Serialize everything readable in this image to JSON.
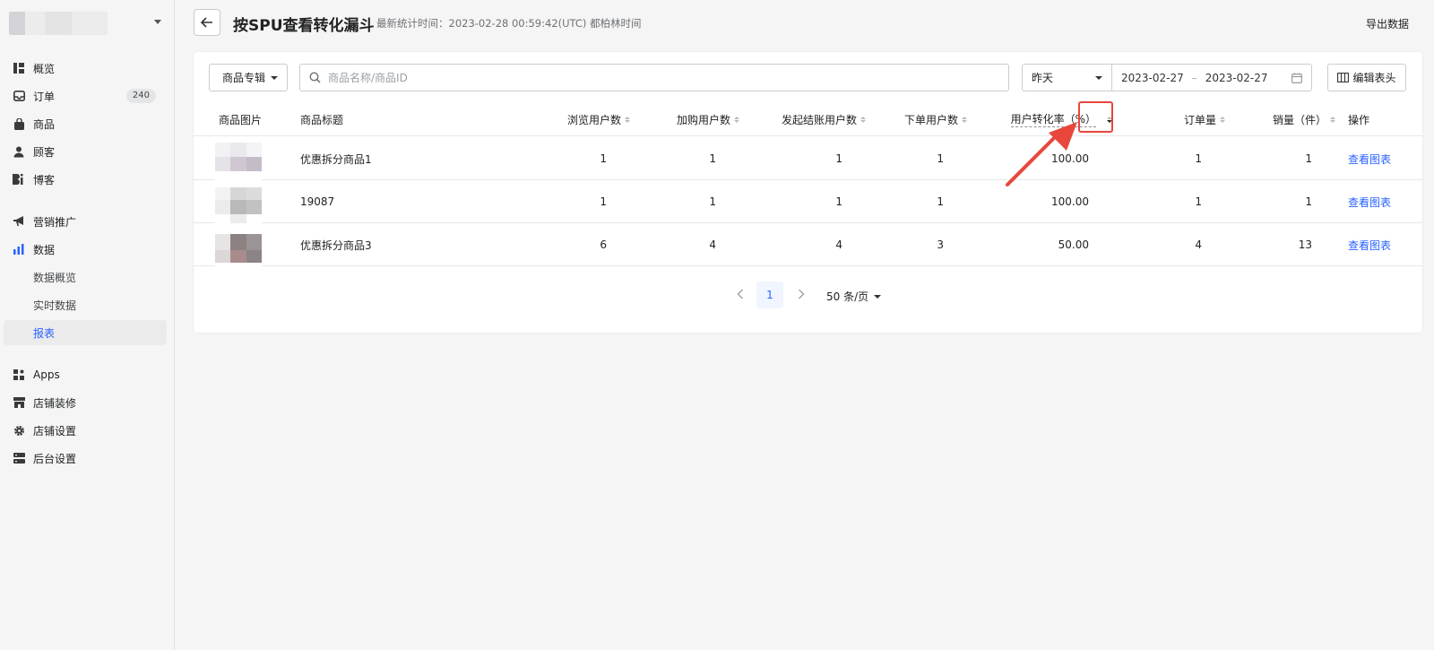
{
  "sidebar": {
    "items": [
      {
        "label": "概览",
        "icon": "overview-icon"
      },
      {
        "label": "订单",
        "icon": "orders-icon",
        "badge": "240"
      },
      {
        "label": "商品",
        "icon": "products-icon"
      },
      {
        "label": "顾客",
        "icon": "customers-icon"
      },
      {
        "label": "博客",
        "icon": "blog-icon"
      },
      {
        "label": "营销推广",
        "icon": "megaphone-icon"
      },
      {
        "label": "数据",
        "icon": "analytics-icon"
      },
      {
        "label": "数据概览"
      },
      {
        "label": "实时数据"
      },
      {
        "label": "报表"
      },
      {
        "label": "Apps",
        "icon": "apps-icon"
      },
      {
        "label": "店铺装修",
        "icon": "store-icon"
      },
      {
        "label": "店铺设置",
        "icon": "gear-icon"
      },
      {
        "label": "后台设置",
        "icon": "server-icon"
      }
    ]
  },
  "header": {
    "title": "按SPU查看转化漏斗",
    "stat_time": "最新统计时间：2023-02-28 00:59:42(UTC) 都柏林时间",
    "export_label": "导出数据"
  },
  "filters": {
    "collection_label": "商品专辑",
    "search_placeholder": "商品名称/商品ID",
    "range_label": "昨天",
    "date_start": "2023-02-27",
    "date_sep": "–",
    "date_end": "2023-02-27",
    "edit_columns_label": "编辑表头"
  },
  "table": {
    "headers": [
      "商品图片",
      "商品标题",
      "浏览用户数",
      "加购用户数",
      "发起结账用户数",
      "下单用户数",
      "用户转化率（%）",
      "订单量",
      "销量（件）",
      "操作"
    ],
    "rows": [
      {
        "title": "优惠拆分商品1",
        "views": "1",
        "add_to_cart": "1",
        "checkout": "1",
        "ordered": "1",
        "conversion": "100.00",
        "orders": "1",
        "sales": "1",
        "action": "查看图表"
      },
      {
        "title": "19087",
        "views": "1",
        "add_to_cart": "1",
        "checkout": "1",
        "ordered": "1",
        "conversion": "100.00",
        "orders": "1",
        "sales": "1",
        "action": "查看图表"
      },
      {
        "title": "优惠拆分商品3",
        "views": "6",
        "add_to_cart": "4",
        "checkout": "4",
        "ordered": "3",
        "conversion": "50.00",
        "orders": "4",
        "sales": "13",
        "action": "查看图表"
      }
    ]
  },
  "pagination": {
    "current_page": "1",
    "page_size": "50 条/页"
  },
  "colors": {
    "accent": "#2962ff",
    "highlight": "#e8473c"
  }
}
